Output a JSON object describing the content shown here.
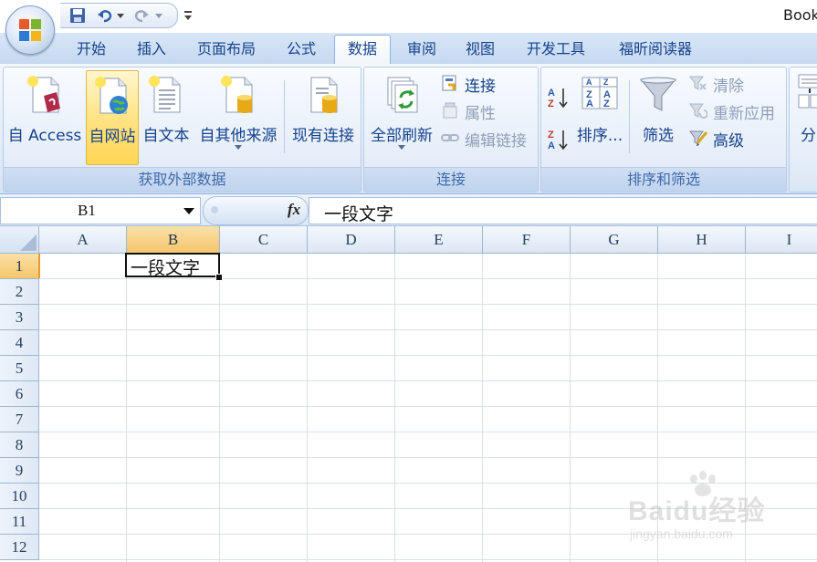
{
  "titlebar": {
    "app_title": "Book"
  },
  "tabs": [
    {
      "label": "开始"
    },
    {
      "label": "插入"
    },
    {
      "label": "页面布局"
    },
    {
      "label": "公式"
    },
    {
      "label": "数据"
    },
    {
      "label": "审阅"
    },
    {
      "label": "视图"
    },
    {
      "label": "开发工具"
    },
    {
      "label": "福昕阅读器"
    }
  ],
  "active_tab": "数据",
  "ribbon": {
    "get_external": {
      "label": "获取外部数据",
      "from_access": "自 Access",
      "from_web": "自网站",
      "from_text": "自文本",
      "from_other": "自其他来源",
      "existing": "现有连接"
    },
    "connections": {
      "label": "连接",
      "refresh_all": "全部刷新",
      "connections": "连接",
      "properties": "属性",
      "edit_links": "编辑链接"
    },
    "sort_filter": {
      "label": "排序和筛选",
      "sort": "排序...",
      "filter": "筛选",
      "clear": "清除",
      "reapply": "重新应用",
      "advanced": "高级"
    },
    "partial": {
      "label": "分"
    }
  },
  "formula_bar": {
    "name_box": "B1",
    "fx": "fx",
    "content": "一段文字"
  },
  "grid": {
    "columns": [
      "A",
      "B",
      "C",
      "D",
      "E",
      "F",
      "G",
      "H",
      "I"
    ],
    "rows": [
      "1",
      "2",
      "3",
      "4",
      "5",
      "6",
      "7",
      "8",
      "9",
      "10",
      "11",
      "12"
    ],
    "selected_column": "B",
    "selected_row": "1",
    "cells": {
      "B1": "一段文字"
    }
  },
  "watermark": {
    "main": "Baidu经验",
    "sub": "jingyan.baidu.com"
  },
  "colors": {
    "ribbon_text": "#15428b",
    "header_selected": "#f5c66c"
  }
}
